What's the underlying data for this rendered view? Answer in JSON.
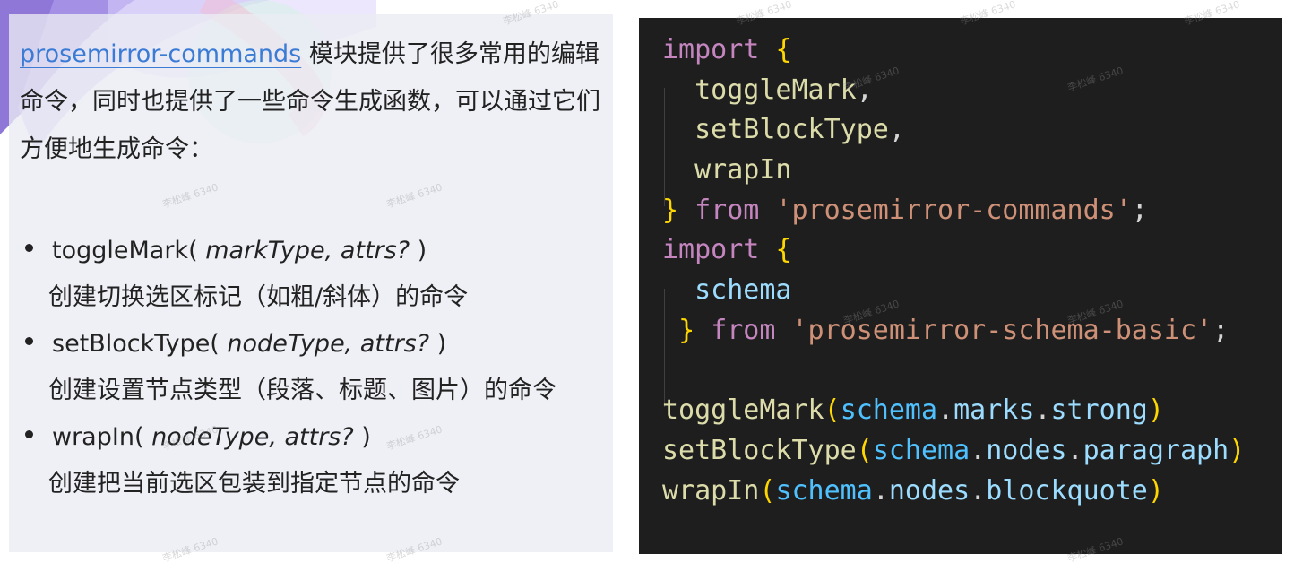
{
  "intro": {
    "module_name": "prosemirror-commands",
    "text": " 模块提供了很多常用的编辑命令，同时也提供了一些命令生成函数，可以通过它们方便地生成命令："
  },
  "commands": [
    {
      "name": "toggleMark(",
      "params": " markType, attrs? ",
      "close": ")",
      "desc": "创建切换选区标记（如粗/斜体）的命令"
    },
    {
      "name": "setBlockType(",
      "params": " nodeType, attrs? ",
      "close": ")",
      "desc": "创建设置节点类型（段落、标题、图片）的命令"
    },
    {
      "name": "wrapIn(",
      "params": " nodeType, attrs? ",
      "close": ")",
      "desc": "创建把当前选区包装到指定节点的命令"
    }
  ],
  "code": {
    "kw_import": "import",
    "kw_from": "from",
    "open_brace": "{",
    "close_brace": "}",
    "semi": ";",
    "comma": ",",
    "dot": ".",
    "lparen": "(",
    "rparen": ")",
    "toggleMark": "toggleMark",
    "setBlockType": "setBlockType",
    "wrapIn": "wrapIn",
    "schema": "schema",
    "commands_module": "'prosemirror-commands'",
    "schema_module": "'prosemirror-schema-basic'",
    "marks": "marks",
    "strong": "strong",
    "nodes": "nodes",
    "paragraph": "paragraph",
    "blockquote": "blockquote"
  },
  "watermark": "李松峰 6340",
  "colors": {
    "code_bg": "#1e1e1e",
    "keyword": "#c586c0",
    "bracket": "#ffd700",
    "function": "#dcdcaa",
    "string": "#ce9178",
    "identifier": "#9cdcfe",
    "link": "#3a7bd5"
  }
}
